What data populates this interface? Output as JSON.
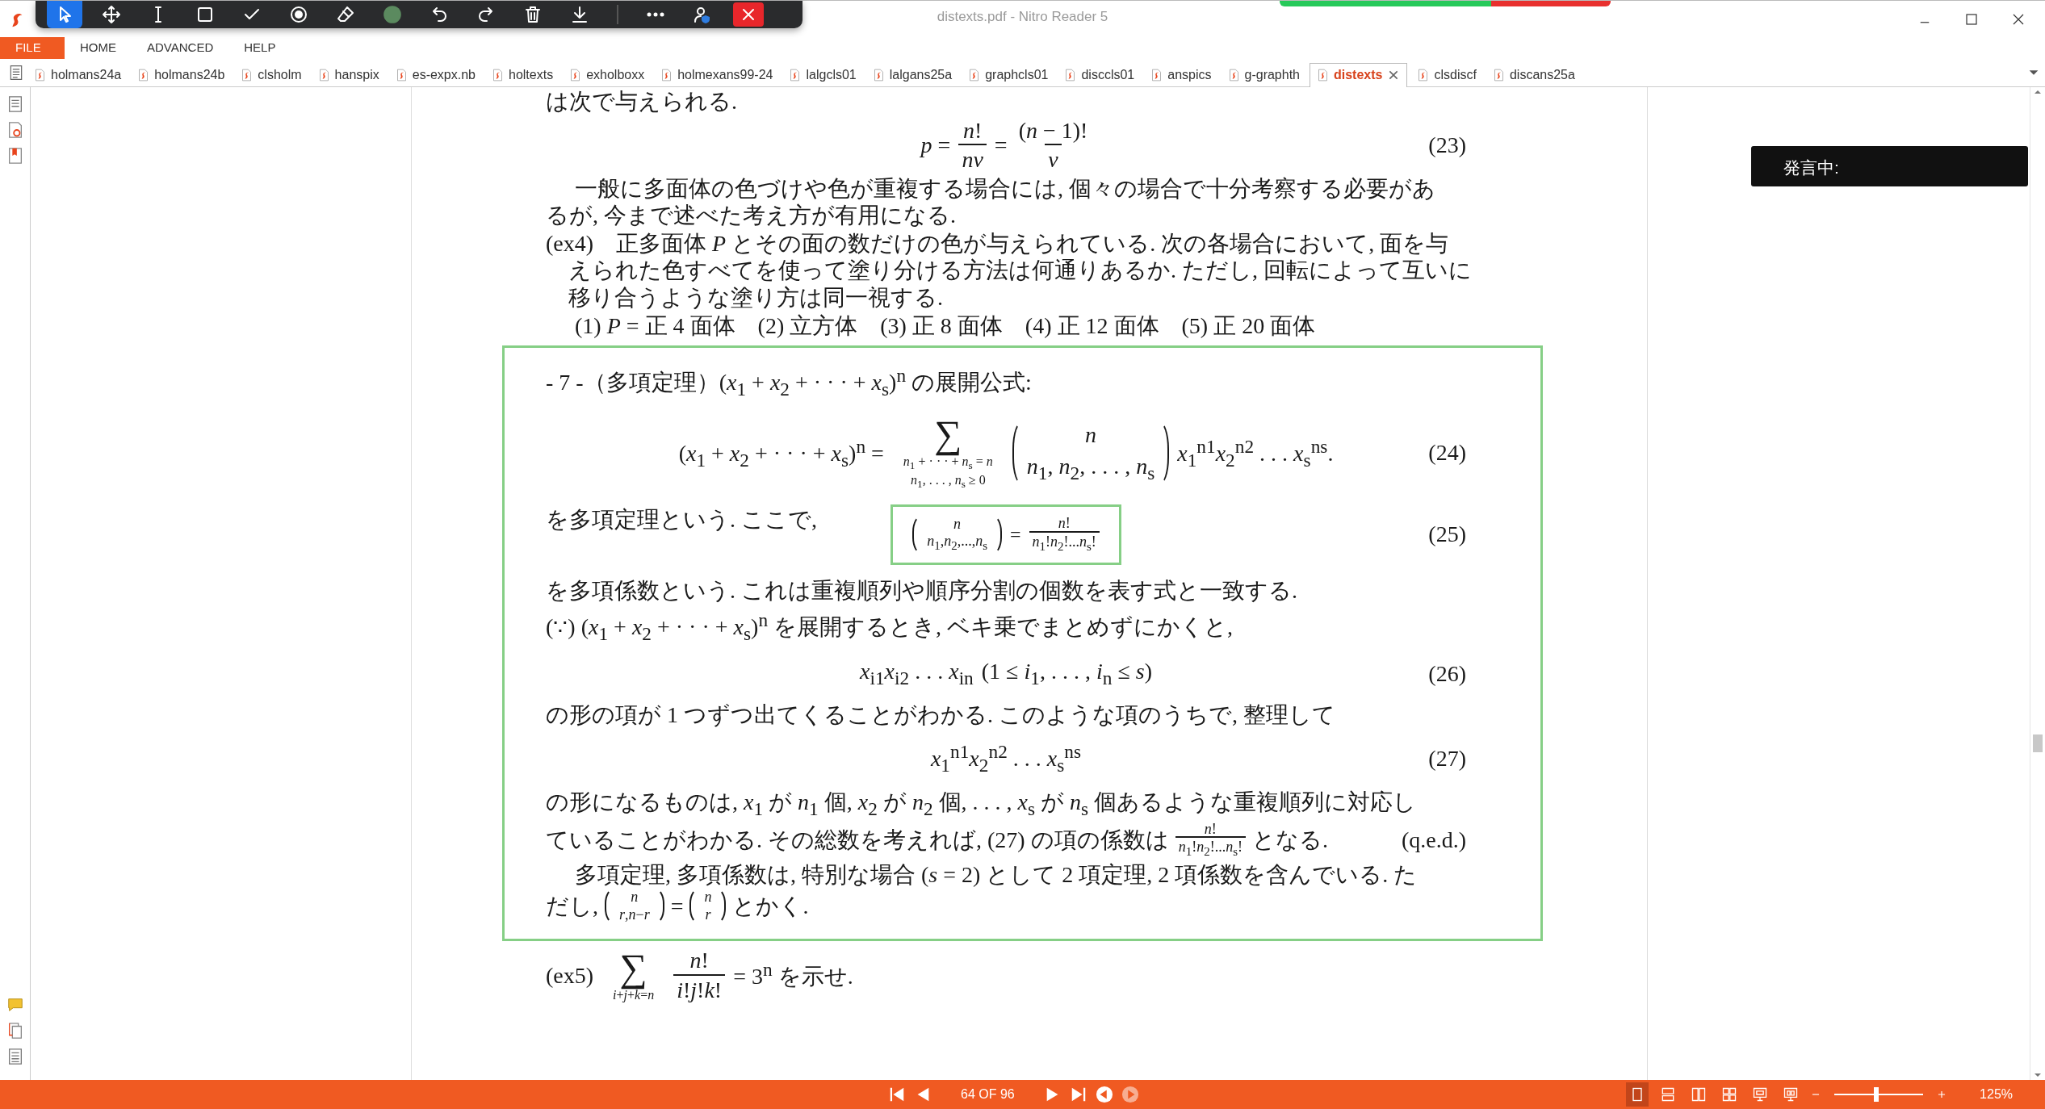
{
  "window": {
    "title": "distexts.pdf - Nitro Reader 5"
  },
  "quick_toolbar": [
    {
      "kind": "pointer",
      "selected": true
    },
    {
      "kind": "pan",
      "selected": false
    },
    {
      "kind": "text-cursor",
      "selected": false
    },
    {
      "kind": "rectangle",
      "selected": false
    },
    {
      "kind": "check",
      "selected": false
    },
    {
      "kind": "stamp",
      "selected": false
    },
    {
      "kind": "eraser",
      "selected": false
    },
    {
      "kind": "color",
      "selected": false,
      "color": "#5b8a5f"
    },
    {
      "kind": "undo",
      "selected": false
    },
    {
      "kind": "redo",
      "selected": false
    },
    {
      "kind": "delete",
      "selected": false
    },
    {
      "kind": "download",
      "selected": false
    },
    {
      "kind": "separator"
    },
    {
      "kind": "more",
      "selected": false
    },
    {
      "kind": "user",
      "selected": false
    },
    {
      "kind": "close",
      "selected": false
    }
  ],
  "menu": [
    {
      "label": "FILE",
      "selected": true
    },
    {
      "label": "HOME",
      "selected": false
    },
    {
      "label": "ADVANCED",
      "selected": false
    },
    {
      "label": "HELP",
      "selected": false
    }
  ],
  "tabs": [
    {
      "label": "holmans24a",
      "selected": false
    },
    {
      "label": "holmans24b",
      "selected": false
    },
    {
      "label": "clsholm",
      "selected": false
    },
    {
      "label": "hanspix",
      "selected": false
    },
    {
      "label": "es-expx.nb",
      "selected": false
    },
    {
      "label": "holtexts",
      "selected": false
    },
    {
      "label": "exholboxx",
      "selected": false
    },
    {
      "label": "holmexans99-24",
      "selected": false
    },
    {
      "label": "lalgcls01",
      "selected": false
    },
    {
      "label": "lalgans25a",
      "selected": false
    },
    {
      "label": "graphcls01",
      "selected": false
    },
    {
      "label": "disccls01",
      "selected": false
    },
    {
      "label": "anspics",
      "selected": false
    },
    {
      "label": "g-graphth",
      "selected": false
    },
    {
      "label": "distexts",
      "selected": true
    },
    {
      "label": "clsdiscf",
      "selected": false
    },
    {
      "label": "discans25a",
      "selected": false
    }
  ],
  "sidebar": {
    "top": [
      {
        "kind": "pages"
      },
      {
        "kind": "attachments"
      },
      {
        "kind": "bookmarks"
      }
    ],
    "bottom": [
      {
        "kind": "comments"
      },
      {
        "kind": "copy"
      },
      {
        "kind": "list"
      }
    ]
  },
  "document": {
    "blocks": [
      {
        "kind": "para",
        "indent": false,
        "lines": [
          "は次で与えられる."
        ]
      },
      {
        "kind": "equation",
        "segments": [
          {
            "kind": "text",
            "text": "*p* ="
          },
          {
            "kind": "frac",
            "num": "*n*!",
            "den": "*nv*"
          },
          {
            "kind": "text",
            "text": "="
          },
          {
            "kind": "frac",
            "num": "(*n* − 1)!",
            "den": "*v*"
          }
        ],
        "number": "(23)"
      },
      {
        "kind": "para",
        "indent": true,
        "lines": [
          "一般に多面体の色づけや色が重複する場合には, 個々の場合で十分考察する必要があ",
          "るが, 今まで述べた考え方が有用になる."
        ]
      },
      {
        "kind": "para",
        "indent": false,
        "lines": [
          "(ex4)　正多面体 *P* とその面の数だけの色が与えられている. 次の各場合において, 面を与",
          "　えられた色すべてを使って塗り分ける方法は何通りあるか. ただし, 回転によって互いに",
          "　移り合うような塗り方は同一視する."
        ]
      },
      {
        "kind": "para",
        "indent": true,
        "lines": [
          "(1)  *P* = 正 4 面体　(2) 立方体　(3) 正 8 面体　(4) 正 12 面体　(5) 正 20 面体"
        ]
      },
      {
        "kind": "box",
        "blocks": [
          {
            "kind": "para",
            "indent": false,
            "lines": [
              "- 7 -（多項定理）(*x*$_{1}$ + *x*$_{2}$ + · · · + *x*$_{s}$)$^{n}$ の展開公式:"
            ]
          },
          {
            "kind": "equation",
            "segments": [
              {
                "kind": "text",
                "text": "(*x*$_{1}$ + *x*$_{2}$ + · · · + *x*$_{s}$)$^{n}$ ="
              },
              {
                "kind": "sum",
                "symbol": "∑",
                "sub": [
                  "*n*$_{1}$ + · · · + *n*$_{s}$ = *n*",
                  "*n*$_{1}$, . . . , *n*$_{s}$ ≥ 0"
                ]
              },
              {
                "kind": "binom",
                "top": "*n*",
                "bottom": "*n*$_{1}$, *n*$_{2}$, . . . , *n*$_{s}$"
              },
              {
                "kind": "text",
                "text": "*x*$_{1}$$^{n1}$*x*$_{2}$$^{n2}$ . . . *x*$_{s}$$^{ns}$."
              }
            ],
            "number": "(24)"
          },
          {
            "kind": "equation",
            "lead": "を多項定理という. ここで,",
            "boxed": true,
            "inline": true,
            "segments": [
              {
                "kind": "binom",
                "top": "*n*",
                "bottom": "*n*$_{1}$,*n*$_{2}$,...,*n*$_{s}$"
              },
              {
                "kind": "text",
                "text": "="
              },
              {
                "kind": "frac",
                "num": "*n*!",
                "den": "*n*$_{1}$!*n*$_{2}$!...*n*$_{s}$!"
              }
            ],
            "number": "(25)"
          },
          {
            "kind": "para",
            "indent": false,
            "lines": [
              "を多項係数という. これは重複順列や順序分割の個数を表す式と一致する."
            ]
          },
          {
            "kind": "para",
            "indent": false,
            "lines": [
              "(∵)  (*x*$_{1}$ + *x*$_{2}$ + · · · + *x*$_{s}$)$^{n}$ を展開するとき, ベキ乗でまとめずにかくと,"
            ]
          },
          {
            "kind": "equation",
            "segments": [
              {
                "kind": "text",
                "text": "*x*$_{i1}$*x*$_{i2}$ . . . *x*$_{in}$"
              },
              {
                "kind": "text",
                "text": "(1 ≤ *i*$_{1}$, . . . , *i*$_{n}$ ≤ *s*)"
              }
            ],
            "number": "(26)"
          },
          {
            "kind": "para",
            "indent": false,
            "lines": [
              "の形の項が 1 つずつ出てくることがわかる. このような項のうちで, 整理して"
            ]
          },
          {
            "kind": "equation",
            "segments": [
              {
                "kind": "text",
                "text": "*x*$_{1}$$^{n1}$*x*$_{2}$$^{n2}$ . . . *x*$_{s}$$^{ns}$"
              }
            ],
            "number": "(27)"
          },
          {
            "kind": "para",
            "indent": false,
            "lines": [
              "の形になるものは, *x*$_{1}$ が *n*$_{1}$ 個, *x*$_{2}$ が *n*$_{2}$ 個, . . . , *x*$_{s}$ が *n*$_{s}$ 個あるような重複順列に対応し",
              [
                {
                  "kind": "text",
                  "text": "ていることがわかる. その総数を考えれば, (27) の項の係数は"
                },
                {
                  "kind": "frac",
                  "num": "*n*!",
                  "den": "*n*$_{1}$!*n*$_{2}$!...*n*$_{s}$!"
                },
                {
                  "kind": "text",
                  "text": "となる."
                },
                {
                  "kind": "end",
                  "text": "(q.e.d.)"
                }
              ]
            ]
          },
          {
            "kind": "para",
            "indent": true,
            "lines": [
              "多項定理, 多項係数は, 特別な場合 (*s* = 2) として 2 項定理, 2 項係数を含んでいる. た",
              [
                {
                  "kind": "text",
                  "text": "だし,"
                },
                {
                  "kind": "binom",
                  "top": "*n*",
                  "bottom": "*r*,*n*−*r*"
                },
                {
                  "kind": "text",
                  "text": "="
                },
                {
                  "kind": "binom",
                  "top": "*n*",
                  "bottom": "*r*"
                },
                {
                  "kind": "text",
                  "text": "とかく."
                }
              ]
            ]
          }
        ]
      },
      {
        "kind": "formula_line",
        "segments": [
          {
            "kind": "text",
            "text": "(ex5)"
          },
          {
            "kind": "sum",
            "symbol": "∑",
            "sub": [
              "*i*+*j*+*k*=*n*"
            ]
          },
          {
            "kind": "frac",
            "num": "*n*!",
            "den": "*i*!*j*!*k*!"
          },
          {
            "kind": "text",
            "text": "= 3$^{n}$ を示せ."
          }
        ]
      }
    ]
  },
  "speech_box": {
    "text": "発言中:"
  },
  "status_bar": {
    "nav_before": [
      {
        "kind": "first"
      },
      {
        "kind": "prev"
      }
    ],
    "page": "64 OF 96",
    "nav_after": [
      {
        "kind": "next",
        "disabled": false
      },
      {
        "kind": "last",
        "disabled": false
      },
      {
        "kind": "back",
        "disabled": false
      },
      {
        "kind": "forward",
        "disabled": true
      }
    ],
    "views": [
      {
        "kind": "single",
        "selected": true
      },
      {
        "kind": "continuous",
        "selected": false
      },
      {
        "kind": "facing",
        "selected": false
      },
      {
        "kind": "grid",
        "selected": false
      },
      {
        "kind": "monitor",
        "selected": false
      },
      {
        "kind": "monitor-split",
        "selected": false
      }
    ],
    "zoom": {
      "level": 0.47,
      "text": "125%"
    }
  }
}
